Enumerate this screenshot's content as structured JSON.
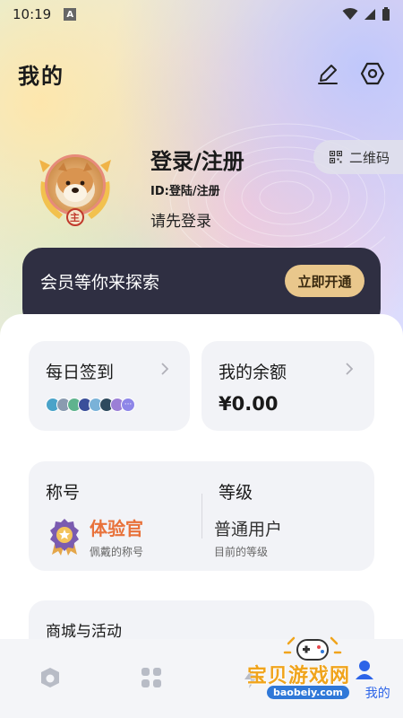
{
  "status_bar": {
    "time": "10:19",
    "notif_badge": "A"
  },
  "header": {
    "title": "我的",
    "icons": [
      "edit-icon",
      "settings-hex-icon"
    ]
  },
  "profile": {
    "login_title": "登录/注册",
    "user_id": "ID:登陆/注册",
    "login_hint": "请先登录",
    "badge_char": "主"
  },
  "qr": {
    "label": "二维码",
    "icon": "qrcode-icon"
  },
  "vip": {
    "text": "会员等你来探索",
    "button": "立即开通",
    "bg": "#2f2f42",
    "accent": "#e9c78c"
  },
  "cards": {
    "checkin": {
      "title": "每日签到"
    },
    "balance": {
      "title": "我的余额",
      "value": "¥0.00"
    },
    "rank": {
      "title_label": "称号",
      "title_value": "体验官",
      "title_sub": "佩戴的称号",
      "level_label": "等级",
      "level_value": "普通用户",
      "level_sub": "目前的等级"
    },
    "mall": {
      "title": "商城与活动"
    }
  },
  "bottom_nav": {
    "items": [
      "home-icon",
      "apps-grid-icon",
      "flash-icon",
      "profile-icon"
    ],
    "active_label": "我的",
    "active_color": "#2c64e8"
  },
  "watermark": {
    "text": "宝贝游戏网",
    "url": "baobeiy.com"
  }
}
